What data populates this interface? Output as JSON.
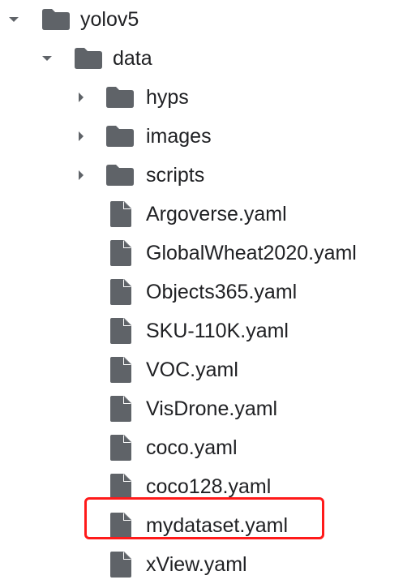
{
  "file_tree": {
    "root": {
      "name": "yolov5",
      "icon": "folder-icon",
      "expanded": true
    },
    "data_folder": {
      "name": "data",
      "icon": "folder-icon",
      "expanded": true
    },
    "subfolders": [
      {
        "name": "hyps",
        "icon": "folder-icon",
        "expanded": false
      },
      {
        "name": "images",
        "icon": "folder-icon",
        "expanded": false
      },
      {
        "name": "scripts",
        "icon": "folder-icon",
        "expanded": false
      }
    ],
    "files": [
      {
        "name": "Argoverse.yaml",
        "icon": "file-icon"
      },
      {
        "name": "GlobalWheat2020.yaml",
        "icon": "file-icon"
      },
      {
        "name": "Objects365.yaml",
        "icon": "file-icon"
      },
      {
        "name": "SKU-110K.yaml",
        "icon": "file-icon"
      },
      {
        "name": "VOC.yaml",
        "icon": "file-icon"
      },
      {
        "name": "VisDrone.yaml",
        "icon": "file-icon"
      },
      {
        "name": "coco.yaml",
        "icon": "file-icon"
      },
      {
        "name": "coco128.yaml",
        "icon": "file-icon"
      },
      {
        "name": "mydataset.yaml",
        "icon": "file-icon",
        "highlighted": true
      },
      {
        "name": "xView.yaml",
        "icon": "file-icon"
      }
    ]
  },
  "colors": {
    "icon": "#5f6368",
    "text": "#202124",
    "highlight_box": "#ff1a1a"
  }
}
